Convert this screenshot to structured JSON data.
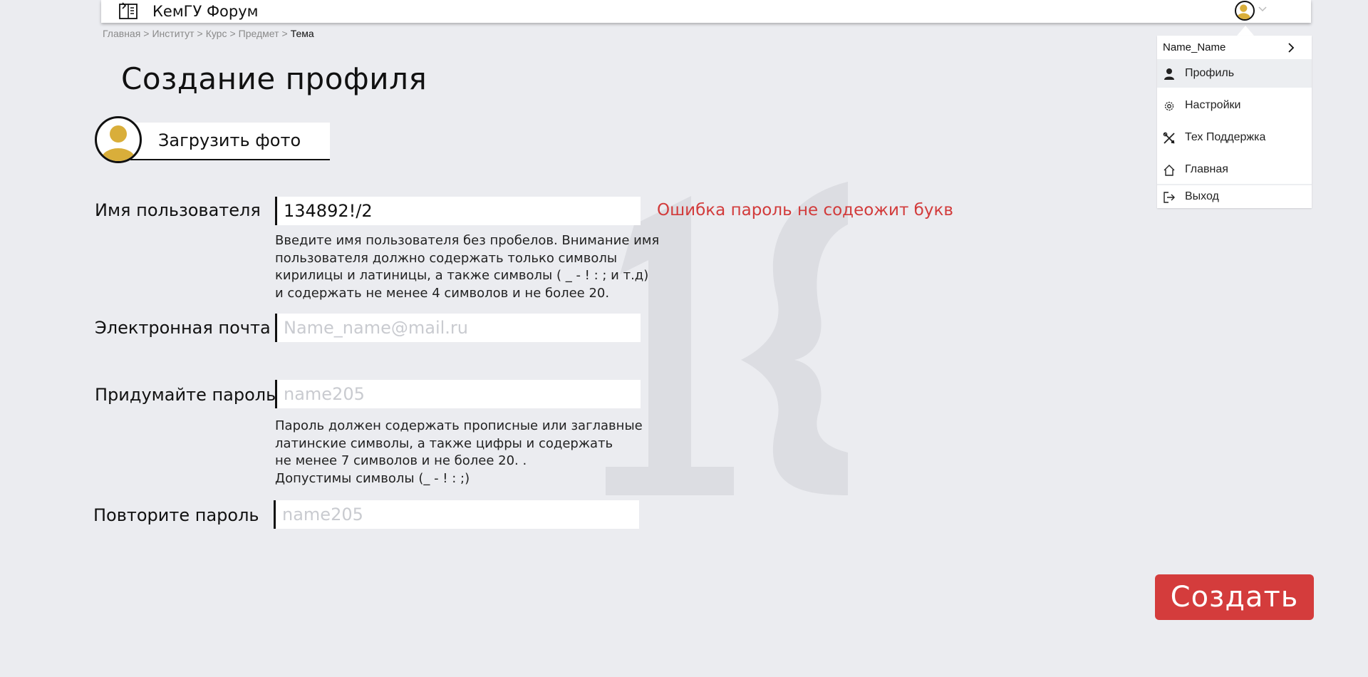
{
  "header": {
    "title": "КемГУ Форум",
    "logo_icon": "book-logo-icon",
    "avatar_icon": "user-avatar-icon"
  },
  "breadcrumb": {
    "items": [
      "Главная",
      "Институт",
      "Курс",
      "Предмет"
    ],
    "separator": ">",
    "current": "Тема"
  },
  "page": {
    "title": "Создание профиля",
    "upload_label": "Загрузить фото"
  },
  "form": {
    "username": {
      "label": "Имя пользователя",
      "value": "134892!/2",
      "hint_lines": [
        "Введите имя пользователя без пробелов. Внимание имя",
        "пользователя должно содержать только символы",
        "кирилицы и латиницы, а также символы ( _  -  !  :  ; и т.д)",
        "и содержать не менее 4 символов и не более 20."
      ],
      "error": "Ошибка пароль не содеожит букв"
    },
    "email": {
      "label": "Электронная почта",
      "placeholder": "Name_name@mail.ru"
    },
    "password": {
      "label": "Придумайте пароль",
      "placeholder": "name205",
      "hint_lines": [
        "Пароль должен содержать прописные или заглавные",
        "латинские символы, а также цифры и содержать",
        "не менее 7 символов и не более 20. .",
        "Допустимы символы (_ - ! : ;)"
      ]
    },
    "password_repeat": {
      "label": "Повторите пароль",
      "placeholder": "name205"
    },
    "submit_label": "Создать"
  },
  "user_menu": {
    "username": "Name_Name",
    "items": [
      {
        "label": "Профиль",
        "icon": "person-icon"
      },
      {
        "label": "Настройки",
        "icon": "gear-icon"
      },
      {
        "label": "Тех Поддержка",
        "icon": "tools-icon"
      },
      {
        "label": "Главная",
        "icon": "home-icon"
      },
      {
        "label": "Выход",
        "icon": "logout-icon"
      }
    ]
  },
  "colors": {
    "background": "#ebecf0",
    "accent_red": "#d43c3c",
    "avatar_gold": "#d9ae3a",
    "error_text": "#d23b3b"
  }
}
